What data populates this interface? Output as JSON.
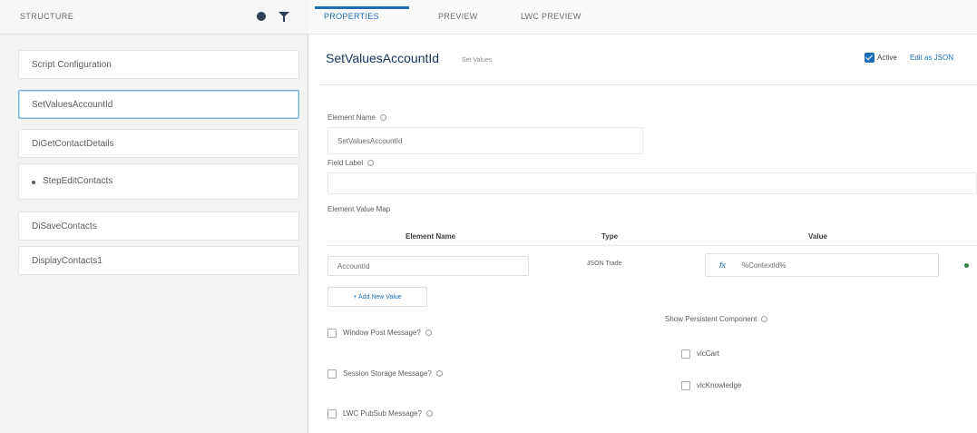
{
  "structure": {
    "title": "STRUCTURE",
    "items": [
      {
        "label": "Script Configuration"
      },
      {
        "label": "SetValuesAccountId"
      },
      {
        "label": "DiGetContactDetails"
      },
      {
        "label": "StepEditContacts"
      },
      {
        "label": "DiSaveContacts"
      },
      {
        "label": "DisplayContacts1"
      }
    ]
  },
  "tabs": [
    {
      "label": "PROPERTIES"
    },
    {
      "label": "PREVIEW"
    },
    {
      "label": "LWC PREVIEW"
    }
  ],
  "element": {
    "title": "SetValuesAccountId",
    "subtitle": "Set Values",
    "active_label": "Active",
    "edit_json_label": "Edit as JSON"
  },
  "form": {
    "element_name_label": "Element Name",
    "element_name_value": "SetValuesAccountId",
    "font_label_label": "Field Label",
    "font_label_value": "",
    "value_map_label": "Element Value Map",
    "columns": [
      "Element Name",
      "Type",
      "Value"
    ],
    "row": {
      "element_name": "AccountId",
      "type": "JSON Trade",
      "fx": "fx",
      "value": "%ContextId%"
    },
    "add_new_value_label": "+ Add New Value",
    "checkboxes_left": [
      {
        "label": "Window Post Message?"
      },
      {
        "label": "Session Storage Message?"
      },
      {
        "label": "LWC PubSub Message?"
      }
    ],
    "persistent_label": "Show Persistent Component",
    "checkboxes_right": [
      {
        "label": "vlcCart"
      },
      {
        "label": "vlcKnowledge"
      }
    ]
  },
  "colors": {
    "accent": "#1b6fb8",
    "title": "#16325c",
    "row_indicator": "#2e844a"
  }
}
